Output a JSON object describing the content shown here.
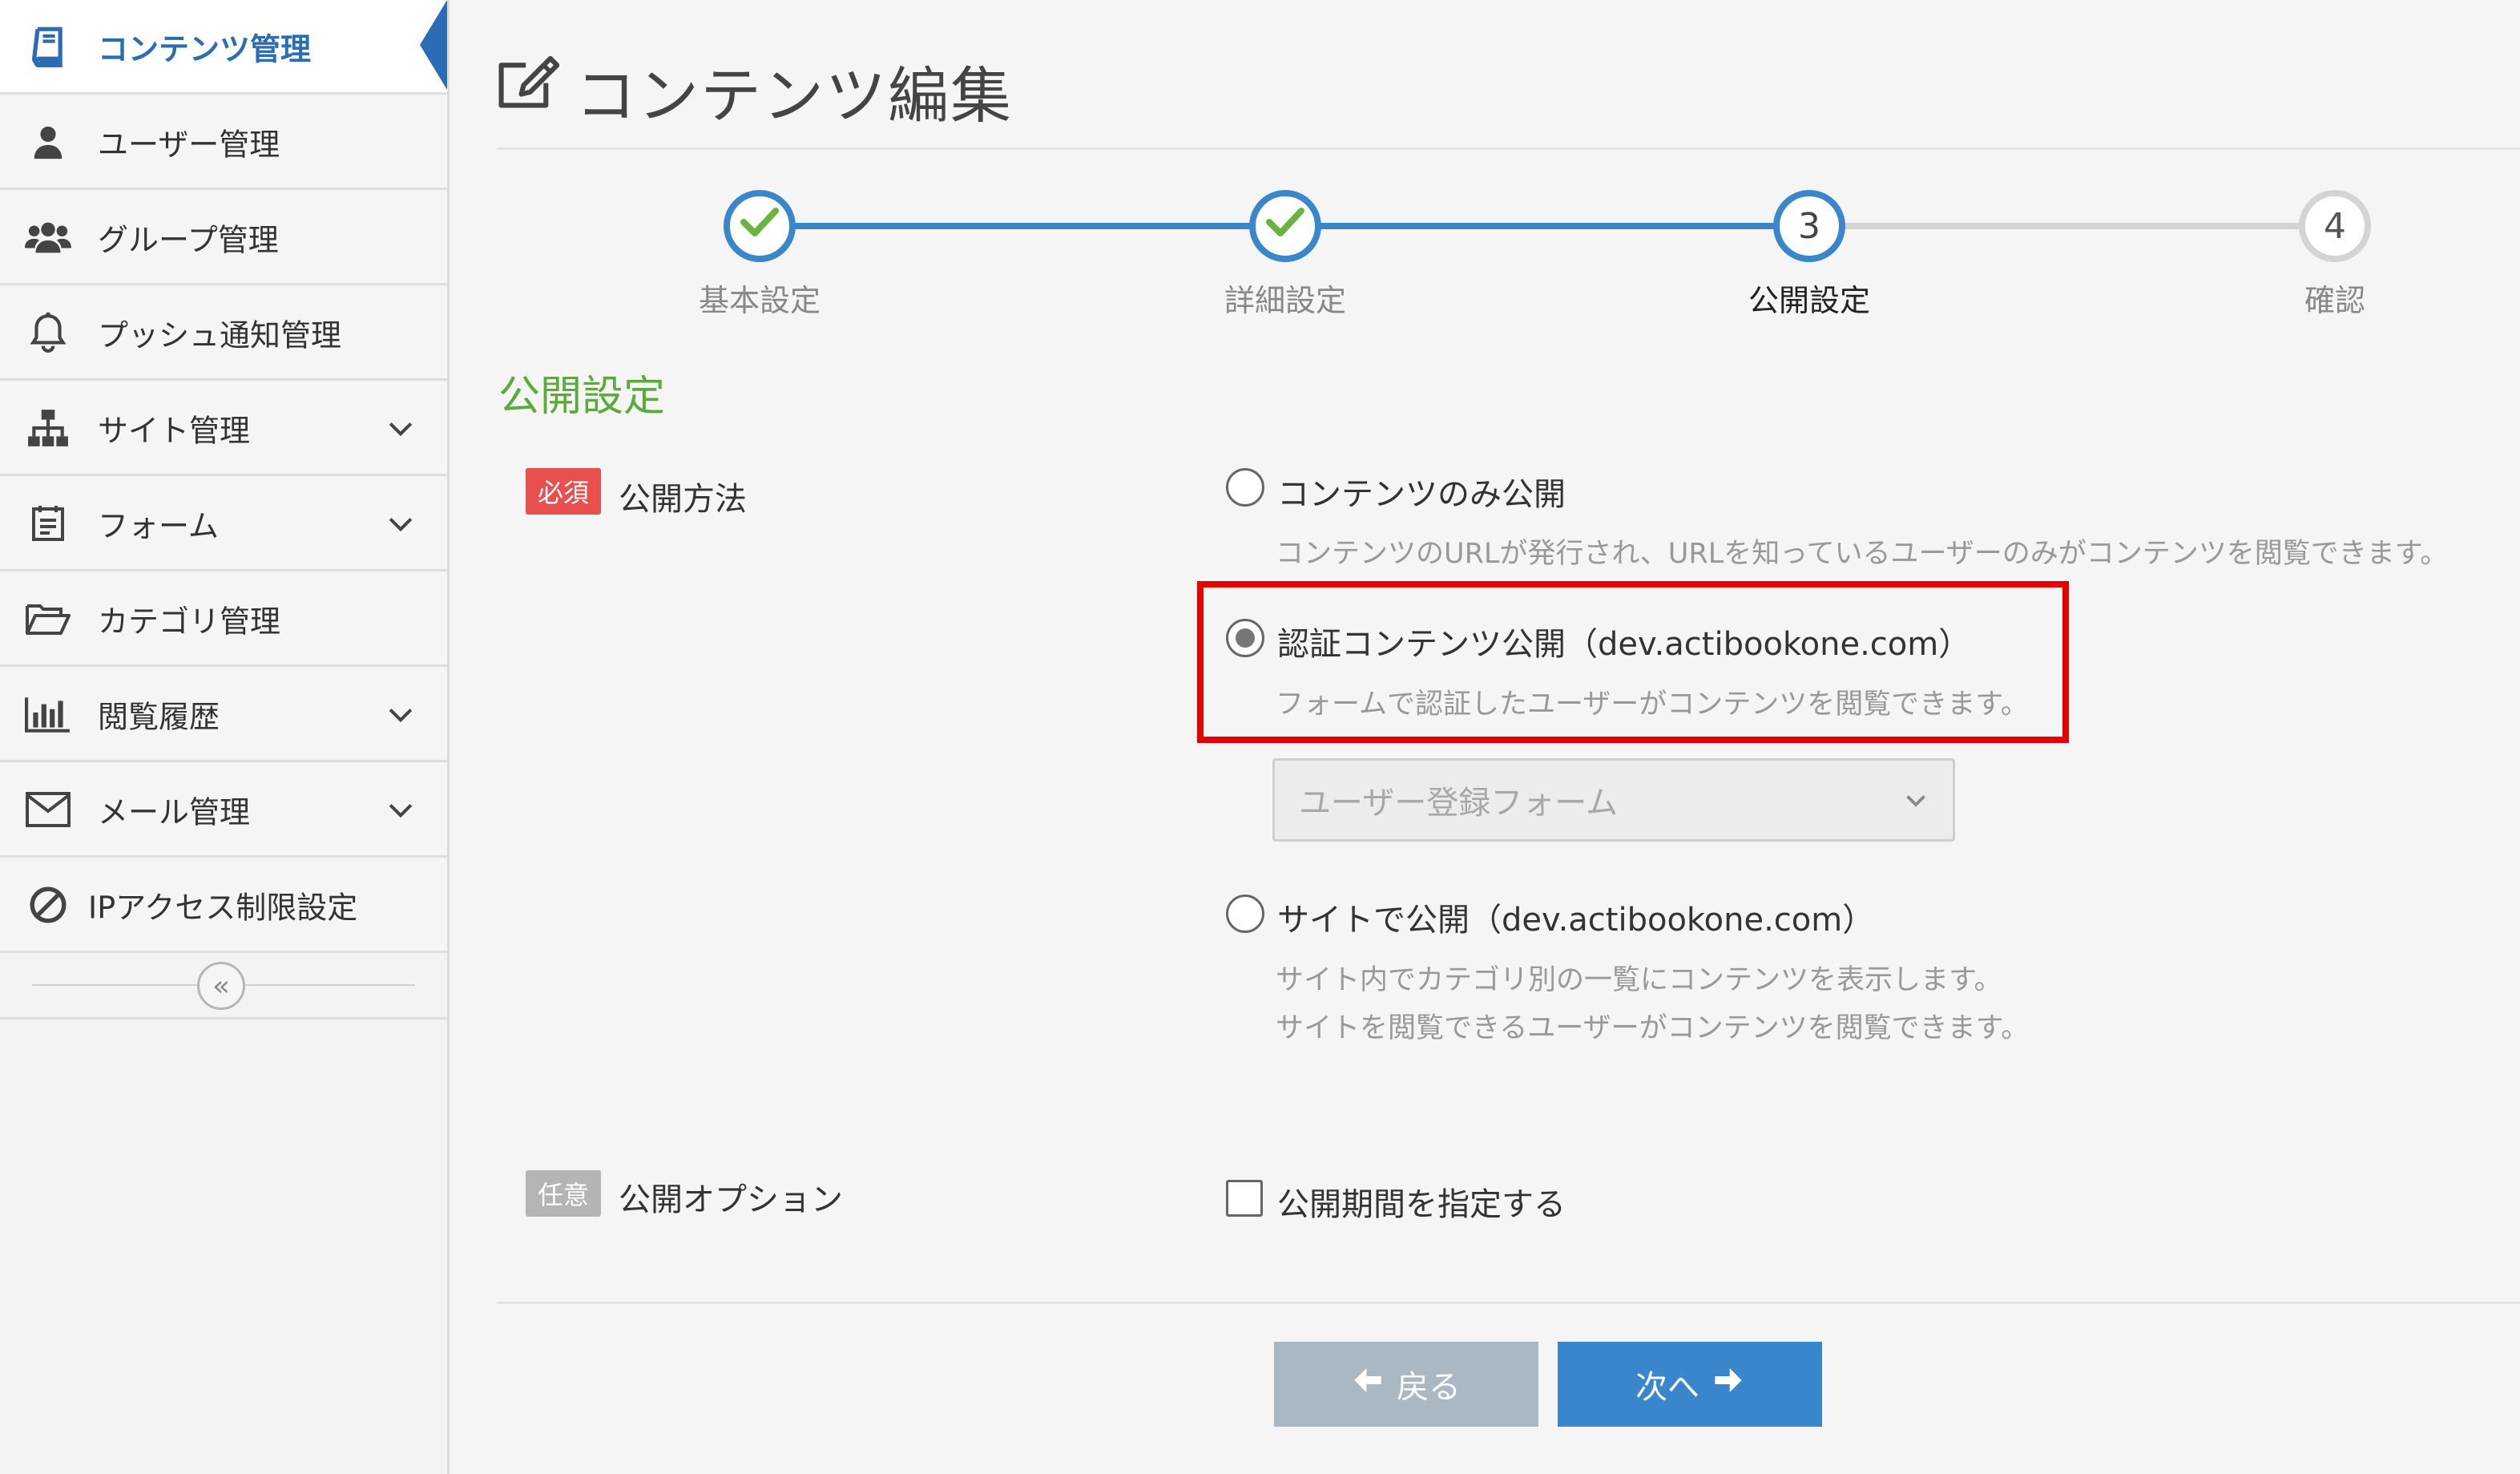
{
  "sidebar": {
    "items": [
      {
        "label": "コンテンツ管理",
        "icon": "book-icon",
        "active": true
      },
      {
        "label": "ユーザー管理",
        "icon": "user-icon"
      },
      {
        "label": "グループ管理",
        "icon": "users-icon"
      },
      {
        "label": "プッシュ通知管理",
        "icon": "bell-icon"
      },
      {
        "label": "サイト管理",
        "icon": "sitemap-icon",
        "expandable": true
      },
      {
        "label": "フォーム",
        "icon": "form-icon",
        "expandable": true
      },
      {
        "label": "カテゴリ管理",
        "icon": "folder-open-icon"
      },
      {
        "label": "閲覧履歴",
        "icon": "bar-chart-icon",
        "expandable": true
      },
      {
        "label": "メール管理",
        "icon": "envelope-icon",
        "expandable": true
      },
      {
        "label": "IPアクセス制限設定",
        "icon": "ban-icon"
      }
    ],
    "collapse_glyph": "«"
  },
  "header": {
    "title": "コンテンツ編集",
    "title_icon": "edit-icon"
  },
  "stepper": {
    "steps": [
      {
        "label": "基本設定",
        "state": "done"
      },
      {
        "label": "詳細設定",
        "state": "done"
      },
      {
        "label": "公開設定",
        "number": "3",
        "state": "current"
      },
      {
        "label": "確認",
        "number": "4",
        "state": "upcoming"
      }
    ]
  },
  "section": {
    "heading": "公開設定"
  },
  "publish_method": {
    "badge": "必須",
    "label": "公開方法",
    "options": [
      {
        "label": "コンテンツのみ公開",
        "desc": "コンテンツのURLが発行され、URLを知っているユーザーのみがコンテンツを閲覧できます。",
        "checked": false
      },
      {
        "label": "認証コンテンツ公開（dev.actibookone.com）",
        "desc": "フォームで認証したユーザーがコンテンツを閲覧できます。",
        "checked": true
      },
      {
        "label": "サイトで公開（dev.actibookone.com）",
        "desc1": "サイト内でカテゴリ別の一覧にコンテンツを表示します。",
        "desc2": "サイトを閲覧できるユーザーがコンテンツを閲覧できます。",
        "checked": false
      }
    ],
    "form_select": {
      "value": "ユーザー登録フォーム"
    }
  },
  "publish_option": {
    "badge": "任意",
    "label": "公開オプション",
    "checkbox_label": "公開期間を指定する",
    "checked": false
  },
  "buttons": {
    "back": "戻る",
    "next": "次へ"
  },
  "colors": {
    "accent_blue": "#2a6db4",
    "step_blue": "#3a86cc",
    "heading_green": "#5aaa3c",
    "required_red": "#e8504f",
    "highlight_red": "#e60000"
  }
}
